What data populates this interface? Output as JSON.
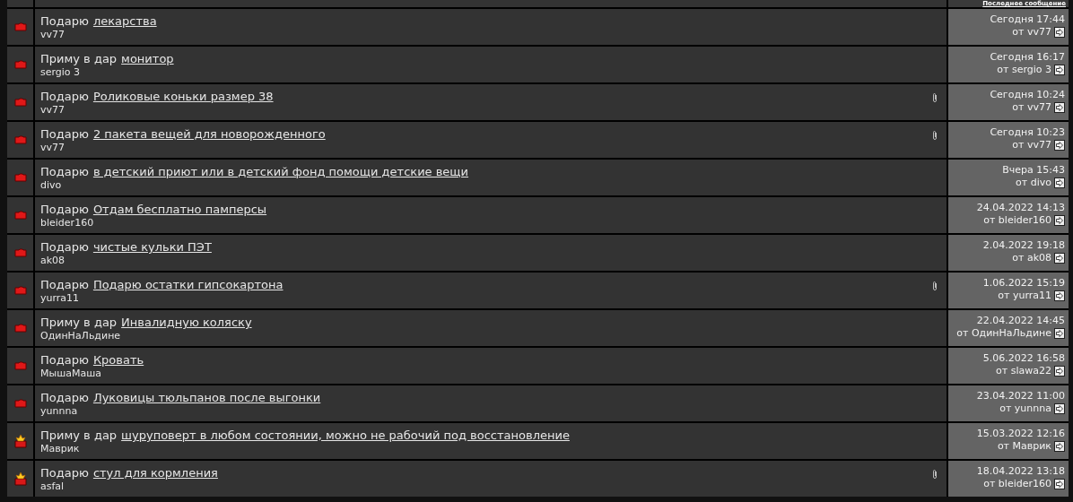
{
  "header": {
    "last_post": "Последнее сообщение"
  },
  "threads": [
    {
      "kind": "normal",
      "prefix": "Подарю",
      "title": "лекарства",
      "author": "vv77",
      "attachment": false,
      "last_date": "Сегодня 17:44",
      "last_by": "от vv77"
    },
    {
      "kind": "normal",
      "prefix": "Приму в дар",
      "title": "монитор",
      "author": "sergio 3",
      "attachment": false,
      "last_date": "Сегодня 16:17",
      "last_by": "от sergio 3"
    },
    {
      "kind": "normal",
      "prefix": "Подарю",
      "title": "Роликовые коньки размер 38",
      "author": "vv77",
      "attachment": true,
      "last_date": "Сегодня 10:24",
      "last_by": "от vv77"
    },
    {
      "kind": "normal",
      "prefix": "Подарю",
      "title": "2 пакета вещей для новорожденного",
      "author": "vv77",
      "attachment": true,
      "last_date": "Сегодня 10:23",
      "last_by": "от vv77"
    },
    {
      "kind": "normal",
      "prefix": "Подарю",
      "title": "в детский приют или в детский фонд помощи детские вещи",
      "author": "divo",
      "attachment": false,
      "last_date": "Вчера 15:43",
      "last_by": "от divo"
    },
    {
      "kind": "normal",
      "prefix": "Подарю",
      "title": "Отдам бесплатно памперсы",
      "author": "bleider160",
      "attachment": false,
      "last_date": "24.04.2022 14:13",
      "last_by": "от bleider160"
    },
    {
      "kind": "normal",
      "prefix": "Подарю",
      "title": "чистые кульки ПЭТ",
      "author": "ak08",
      "attachment": false,
      "last_date": "2.04.2022 19:18",
      "last_by": "от ak08"
    },
    {
      "kind": "normal",
      "prefix": "Подарю",
      "title": "Подарю остатки гипсокартона",
      "author": "yurra11",
      "attachment": true,
      "last_date": "1.06.2022 15:19",
      "last_by": "от yurra11"
    },
    {
      "kind": "normal",
      "prefix": "Приму в дар",
      "title": "Инвалидную коляску",
      "author": "ОдинНаЛьдине",
      "attachment": false,
      "last_date": "22.04.2022 14:45",
      "last_by": "от ОдинНаЛьдине"
    },
    {
      "kind": "normal",
      "prefix": "Подарю",
      "title": "Кровать",
      "author": "МышаМаша",
      "attachment": false,
      "last_date": "5.06.2022 16:58",
      "last_by": "от slawa22"
    },
    {
      "kind": "normal",
      "prefix": "Подарю",
      "title": "Луковицы тюльпанов после выгонки",
      "author": "yunnna",
      "attachment": false,
      "last_date": "23.04.2022 11:00",
      "last_by": "от yunnna"
    },
    {
      "kind": "hot",
      "prefix": "Приму в дар",
      "title": "шуруповерт в любом состоянии, можно не рабочий под восстановление",
      "author": "Маврик",
      "attachment": false,
      "last_date": "15.03.2022 12:16",
      "last_by": "от Маврик"
    },
    {
      "kind": "hot",
      "prefix": "Подарю",
      "title": "стул для кормления",
      "author": "asfal",
      "attachment": true,
      "last_date": "18.04.2022 13:18",
      "last_by": "от bleider160"
    }
  ]
}
